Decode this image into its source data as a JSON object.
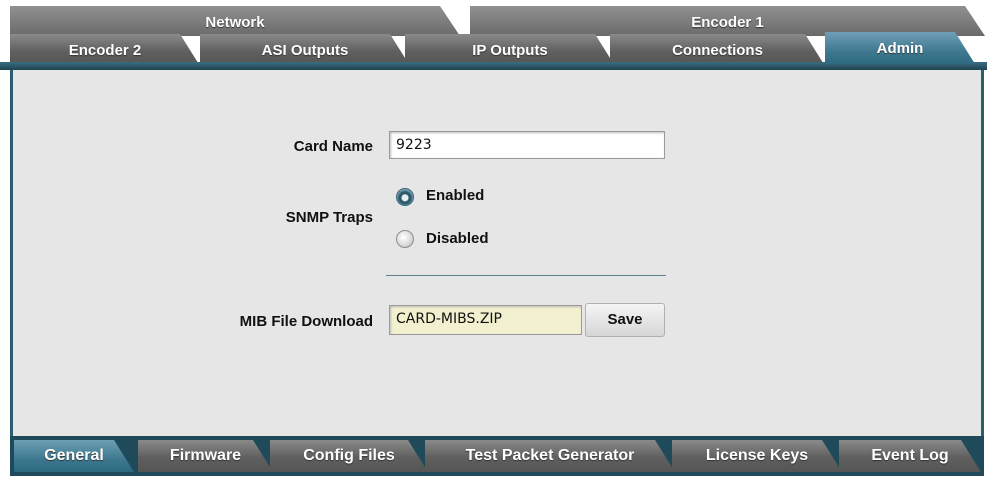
{
  "tabs_back": [
    {
      "label": "Network",
      "active": false
    },
    {
      "label": "Encoder 1",
      "active": false
    }
  ],
  "tabs_front": [
    {
      "label": "Encoder 2",
      "active": false
    },
    {
      "label": "ASI Outputs",
      "active": false
    },
    {
      "label": "IP Outputs",
      "active": false
    },
    {
      "label": "Connections",
      "active": false
    },
    {
      "label": "Admin",
      "active": true
    }
  ],
  "form": {
    "card_name_label": "Card Name",
    "card_name_value": "9223",
    "snmp_label": "SNMP Traps",
    "snmp_enabled_label": "Enabled",
    "snmp_disabled_label": "Disabled",
    "snmp_selected": "Enabled",
    "mib_label": "MIB File Download",
    "mib_value": "CARD-MIBS.ZIP",
    "save_label": "Save"
  },
  "tabs_bottom": [
    {
      "label": "General",
      "active": true
    },
    {
      "label": "Firmware",
      "active": false
    },
    {
      "label": "Config Files",
      "active": false
    },
    {
      "label": "Test Packet Generator",
      "active": false
    },
    {
      "label": "License Keys",
      "active": false
    },
    {
      "label": "Event Log",
      "active": false
    }
  ],
  "colors": {
    "active_tab": "#3f7990",
    "inactive_tab": "#5f5f5f",
    "panel_bg": "#e6e6e6",
    "readonly_field": "#f2f0cf"
  }
}
